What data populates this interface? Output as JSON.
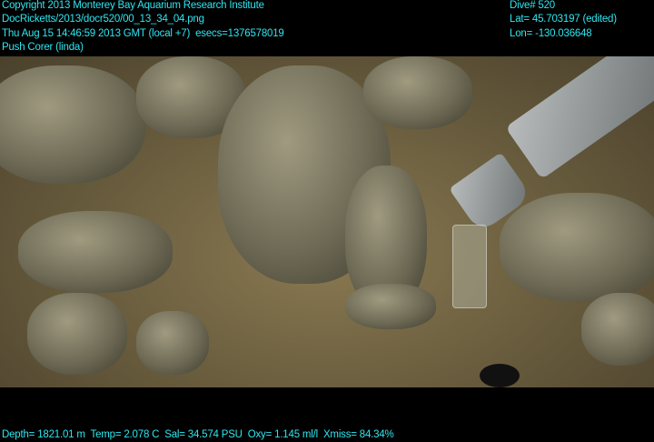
{
  "overlay": {
    "copyright": "Copyright 2013 Monterey Bay Aquarium Research Institute",
    "file_path": "DocRicketts/2013/docr520/00_13_34_04.png",
    "timestamp": "Thu Aug 15 14:46:59 2013 GMT (local +7)  esecs=1376578019",
    "event": "Push Corer (linda)",
    "dive": "Dive# 520",
    "lat": "Lat= 45.703197 (edited)",
    "lon": "Lon= -130.036648",
    "sensors": "Depth= 1821.01 m  Temp= 2.078 C  Sal= 34.574 PSU  Oxy= 1.145 ml/l  Xmiss= 84.34%"
  },
  "colors": {
    "text": "#2ee6f0",
    "background": "#000000"
  }
}
